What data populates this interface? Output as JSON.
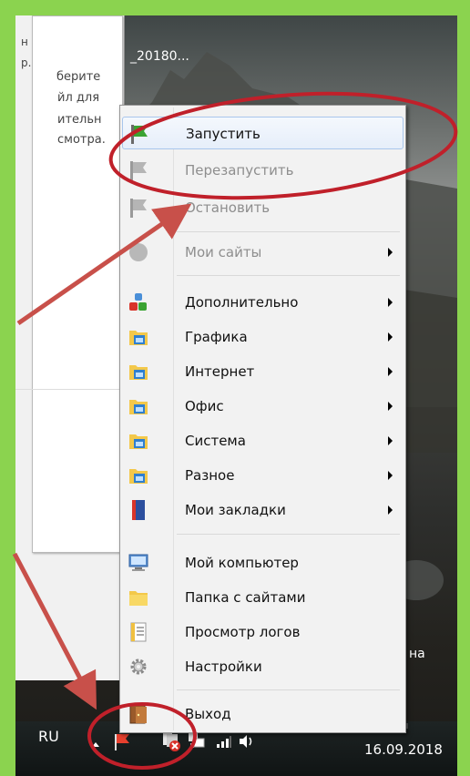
{
  "background_window": {
    "fragments": [
      "н",
      "р."
    ],
    "lines": [
      "берите",
      "йл для",
      "ительн",
      "смотра."
    ]
  },
  "window_title": "_20180...",
  "stray_label": "на",
  "context_menu": {
    "items": [
      {
        "label": "Запустить",
        "icon": "green-flag-icon",
        "disabled": false,
        "submenu": false,
        "highlighted": true
      },
      {
        "label": "Перезапустить",
        "icon": "gray-flag-icon",
        "disabled": true,
        "submenu": false
      },
      {
        "label": "Остановить",
        "icon": "gray-flag-icon",
        "disabled": true,
        "submenu": false
      },
      {
        "label": "Мои сайты",
        "icon": "gray-circle-icon",
        "disabled": true,
        "submenu": true
      },
      {
        "label": "Дополнительно",
        "icon": "colored-blocks-icon",
        "disabled": false,
        "submenu": true
      },
      {
        "label": "Графика",
        "icon": "folder-app-icon",
        "disabled": false,
        "submenu": true
      },
      {
        "label": "Интернет",
        "icon": "folder-app-icon",
        "disabled": false,
        "submenu": true
      },
      {
        "label": "Офис",
        "icon": "folder-app-icon",
        "disabled": false,
        "submenu": true
      },
      {
        "label": "Система",
        "icon": "folder-app-icon",
        "disabled": false,
        "submenu": true
      },
      {
        "label": "Разное",
        "icon": "folder-app-icon",
        "disabled": false,
        "submenu": true
      },
      {
        "label": "Мои закладки",
        "icon": "bookmarks-book-icon",
        "disabled": false,
        "submenu": true
      },
      {
        "label": "Мой компьютер",
        "icon": "computer-icon",
        "disabled": false,
        "submenu": false
      },
      {
        "label": "Папка с сайтами",
        "icon": "folder-icon",
        "disabled": false,
        "submenu": false
      },
      {
        "label": "Просмотр логов",
        "icon": "log-notepad-icon",
        "disabled": false,
        "submenu": false
      },
      {
        "label": "Настройки",
        "icon": "gear-icon",
        "disabled": false,
        "submenu": false
      },
      {
        "label": "Выход",
        "icon": "exit-door-icon",
        "disabled": false,
        "submenu": false
      }
    ]
  },
  "taskbar": {
    "language": "RU",
    "date": "16.09.2018",
    "tray_icons": [
      "show-hidden-icons-arrow",
      "red-flag-icon",
      "action-center-error-icon",
      "network-icon",
      "signal-bars-icon",
      "volume-icon"
    ]
  },
  "colors": {
    "page_background": "#8bd34f",
    "annotation_red": "#c0202a",
    "arrow_red": "#c8504a",
    "menu_background": "#f2f2f2",
    "highlight_border": "#a8c6ec"
  }
}
